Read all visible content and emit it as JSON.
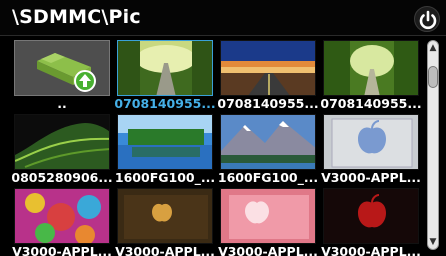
{
  "header": {
    "path": "\\SDMMC\\Pic",
    "power_icon": "power-icon"
  },
  "colors": {
    "selected_label": "#45b0e8",
    "selected_border": "#3aa0d8"
  },
  "items": [
    {
      "label": "..",
      "type": "parent-folder",
      "icon": "folder-up-icon"
    },
    {
      "label": "0708140955...",
      "type": "image",
      "selected": true
    },
    {
      "label": "0708140955...",
      "type": "image"
    },
    {
      "label": "0708140955...",
      "type": "image"
    },
    {
      "label": "0805280906...",
      "type": "image"
    },
    {
      "label": "1600FG100_...",
      "type": "image"
    },
    {
      "label": "1600FG100_...",
      "type": "image"
    },
    {
      "label": "V3000-APPL...",
      "type": "image"
    },
    {
      "label": "V3000-APPL...",
      "type": "image"
    },
    {
      "label": "V3000-APPL...",
      "type": "image"
    },
    {
      "label": "V3000-APPL...",
      "type": "image"
    },
    {
      "label": "V3000-APPL...",
      "type": "image"
    }
  ],
  "scrollbar": {
    "up_arrow": "▲",
    "down_arrow": "▼",
    "position_fraction": 0.05
  }
}
